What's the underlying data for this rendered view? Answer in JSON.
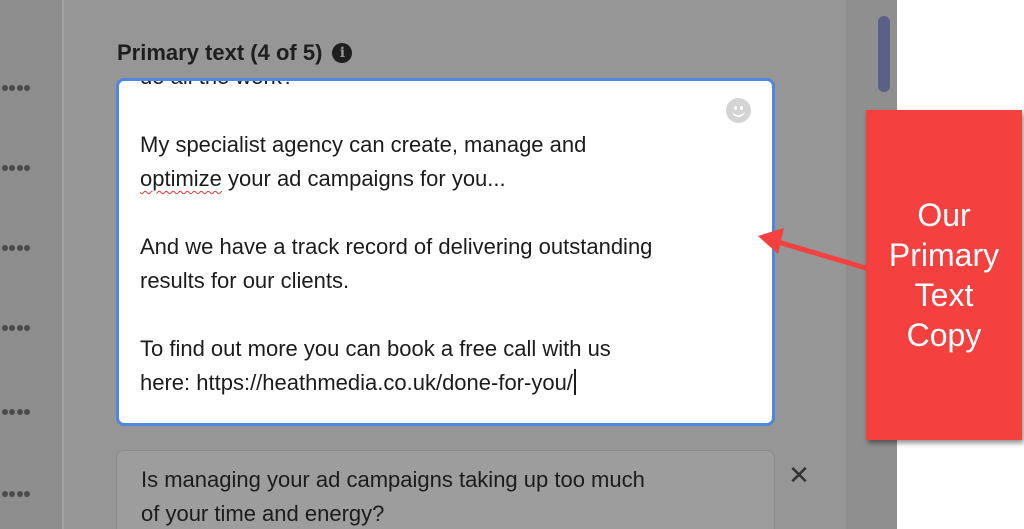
{
  "primary_text": {
    "label": "Primary text (4 of 5)",
    "info_icon": "info-icon",
    "emoji_icon": "emoji-smiley-icon",
    "editor_lines": {
      "line_0": "do all the work?",
      "line_1": "My specialist agency can create, manage and",
      "line_2_underlined": "optimize",
      "line_2_rest": " your ad campaigns for you...",
      "line_3": "And we have a track record of delivering outstanding",
      "line_4": "results for our clients.",
      "line_5": "To find out more you can book a free call with us",
      "line_6": "here: https://heathmedia.co.uk/done-for-you/"
    }
  },
  "next_variation": {
    "line_1": "Is managing your ad campaigns taking up too much",
    "line_2": "of your time and energy?",
    "close_icon": "close-icon"
  },
  "callout": {
    "lines": [
      "Our",
      "Primary",
      "Text",
      "Copy"
    ],
    "color": "#f4403f"
  },
  "colors": {
    "editor_border": "#4f86e0",
    "overlay_panel": "#969696",
    "scrollbar_thumb": "#5a6088"
  }
}
